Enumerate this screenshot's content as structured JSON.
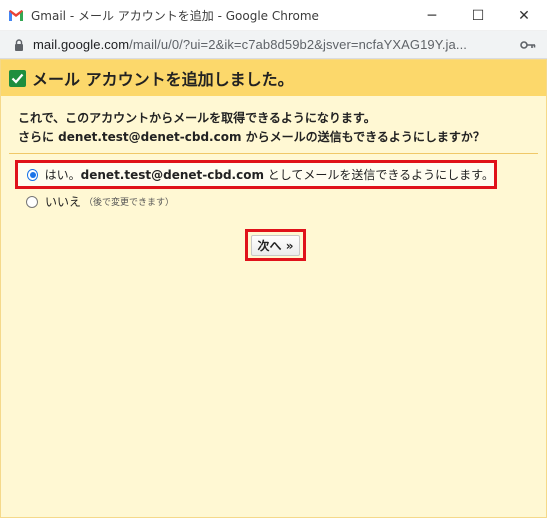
{
  "window": {
    "title": "Gmail - メール アカウントを追加 - Google Chrome",
    "controls": {
      "minimize": "─",
      "maximize": "☐",
      "close": "✕"
    }
  },
  "address": {
    "host": "mail.google.com",
    "path": "/mail/u/0/?ui=2&ik=c7ab8d59b2&jsver=ncfaYXAG19Y.ja..."
  },
  "dialog": {
    "heading": "メール アカウントを追加しました。",
    "description_line1": "これで、このアカウントからメールを取得できるようになります。",
    "description_line2": "さらに denet.test@denet-cbd.com からメールの送信もできるようにしますか？",
    "yes_prefix": "はい。",
    "yes_email": "denet.test@denet-cbd.com",
    "yes_suffix": " としてメールを送信できるようにします。",
    "yes_selected": true,
    "no_label": "いいえ",
    "no_note": "（後で変更できます）",
    "next_button": "次へ »"
  },
  "colors": {
    "header_band": "#fcd86b",
    "content_bg": "#fff8d3",
    "highlight_border": "#e0121a",
    "radio_accent": "#1a73e8"
  },
  "icons": [
    "gmail-logo-icon",
    "lock-icon",
    "key-icon",
    "checkmark-icon"
  ]
}
